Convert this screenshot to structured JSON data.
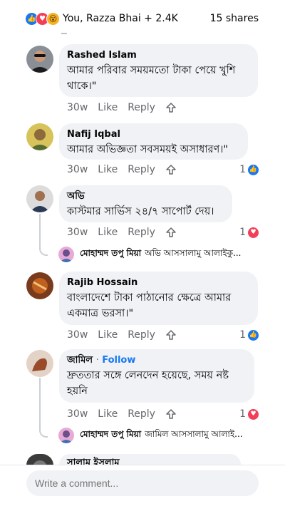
{
  "header": {
    "reactions_text": "You, Razza Bhai + 2.4K",
    "shares_text": "15 shares"
  },
  "actions": {
    "like": "Like",
    "reply": "Reply"
  },
  "comments": [
    {
      "name": "Rashed Islam",
      "text": "আমার পরিবার সময়মতো টাকা পেয়ে খুশি থাকে।\"",
      "time": "30w",
      "count": ""
    },
    {
      "name": "Nafij Iqbal",
      "text": "আমার অভিজ্ঞতা সবসময়ই অসাধারণ।\"",
      "time": "30w",
      "count": "1",
      "count_icon": "like-icon"
    },
    {
      "name": "অভি",
      "text": "কাস্টমার সার্ভিস ২৪/৭ সাপোর্ট দেয়।",
      "time": "30w",
      "count": "1",
      "count_icon": "love-icon",
      "reply": {
        "name": "মোহাম্মদ তপু মিয়া",
        "text": "অভি আসসালামু আলাইকু..."
      }
    },
    {
      "name": "Rajib Hossain",
      "text": "বাংলাদেশে টাকা পাঠানোর ক্ষেত্রে আমার একমাত্র ভরসা।\"",
      "time": "30w",
      "count": "1",
      "count_icon": "like-icon"
    },
    {
      "name": "জামিল",
      "follow_sep": "·",
      "follow": "Follow",
      "text": "দ্রুততার সঙ্গে লেনদেন হয়েছে, সময় নষ্ট হয়নি",
      "time": "30w",
      "count": "1",
      "count_icon": "love-icon",
      "reply": {
        "name": "মোহাম্মদ তপু মিয়া",
        "text": "জামিল আসসালামু আলাই..."
      }
    },
    {
      "name": "সালাম ইসলাম"
    }
  ],
  "composer": {
    "placeholder": "Write a comment..."
  },
  "colors": {
    "like_blue": "#1877f2",
    "love_red": "#f33e58",
    "bubble_bg": "#f0f2f5",
    "muted_text": "#65676b"
  }
}
